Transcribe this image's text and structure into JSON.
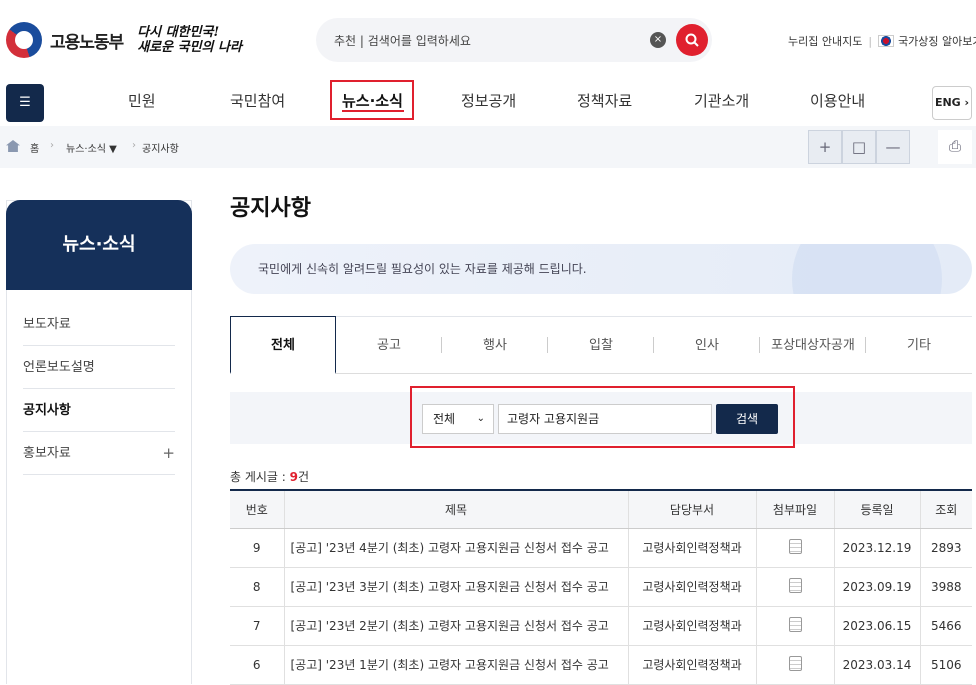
{
  "header": {
    "org_name": "고용노동부",
    "slogan_line1": "다시 대한민국!",
    "slogan_line2": "새로운 국민의 나라",
    "search_placeholder": "추천 | 검색어를 입력하세요",
    "clear_label": "×",
    "sitemap_label": "누리집 안내지도",
    "symbol_label": "국가상징 알아보기"
  },
  "gnb": {
    "menu_label": "☰",
    "items": [
      "민원",
      "국민참여",
      "뉴스·소식",
      "정보공개",
      "정책자료",
      "기관소개",
      "이용안내"
    ],
    "active": "뉴스·소식",
    "lang_label": "ENG ›"
  },
  "breadcrumb": {
    "home": "홈",
    "level1": "뉴스·소식 ▼",
    "level2": "공지사항"
  },
  "tools": {
    "zoom_in": "+",
    "reset": "□",
    "zoom_out": "—",
    "print": "⎙"
  },
  "sidebar": {
    "title": "뉴스·소식",
    "items": [
      {
        "label": "보도자료"
      },
      {
        "label": "언론보도설명"
      },
      {
        "label": "공지사항"
      },
      {
        "label": "홍보자료",
        "expand": "+"
      }
    ]
  },
  "page": {
    "title": "공지사항",
    "intro": "국민에게 신속히 알려드릴 필요성이 있는 자료를 제공해 드립니다.",
    "tabs": [
      "전체",
      "공고",
      "행사",
      "입찰",
      "인사",
      "포상대상자공개",
      "기타"
    ],
    "active_tab": "전체"
  },
  "search": {
    "select_value": "전체",
    "keyword": "고령자 고용지원금",
    "button": "검색"
  },
  "list": {
    "total_prefix": "총 게시글 : ",
    "total_count": "9",
    "total_suffix": "건",
    "columns": [
      "번호",
      "제목",
      "담당부서",
      "첨부파일",
      "등록일",
      "조회"
    ],
    "rows": [
      {
        "no": "9",
        "title": "[공고] '23년 4분기 (최초) 고령자 고용지원금 신청서 접수 공고",
        "dept": "고령사회인력정책과",
        "date": "2023.12.19",
        "views": "2893"
      },
      {
        "no": "8",
        "title": "[공고] '23년 3분기 (최초) 고령자 고용지원금 신청서 접수 공고",
        "dept": "고령사회인력정책과",
        "date": "2023.09.19",
        "views": "3988"
      },
      {
        "no": "7",
        "title": "[공고] '23년 2분기 (최초) 고령자 고용지원금 신청서 접수 공고",
        "dept": "고령사회인력정책과",
        "date": "2023.06.15",
        "views": "5466"
      },
      {
        "no": "6",
        "title": "[공고] '23년 1분기 (최초) 고령자 고용지원금 신청서 접수 공고",
        "dept": "고령사회인력정책과",
        "date": "2023.03.14",
        "views": "5106"
      }
    ]
  },
  "colors": {
    "navy": "#13294b",
    "accent_red": "#e0202e"
  }
}
